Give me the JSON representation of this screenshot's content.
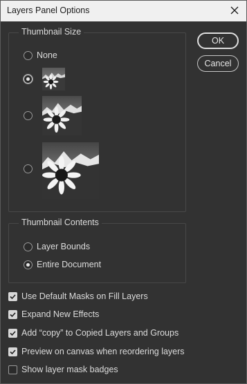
{
  "window": {
    "title": "Layers Panel Options",
    "close_icon": "close-icon"
  },
  "buttons": {
    "ok": "OK",
    "cancel": "Cancel"
  },
  "thumbnail_size": {
    "label": "Thumbnail Size",
    "options": [
      {
        "id": "none",
        "label": "None",
        "selected": false
      },
      {
        "id": "small",
        "label": "",
        "selected": true
      },
      {
        "id": "medium",
        "label": "",
        "selected": false
      },
      {
        "id": "large",
        "label": "",
        "selected": false
      }
    ]
  },
  "thumbnail_contents": {
    "label": "Thumbnail Contents",
    "options": [
      {
        "id": "layer-bounds",
        "label": "Layer Bounds",
        "selected": false
      },
      {
        "id": "entire-document",
        "label": "Entire Document",
        "selected": true
      }
    ]
  },
  "checkboxes": [
    {
      "label": "Use Default Masks on Fill Layers",
      "checked": true
    },
    {
      "label": "Expand New Effects",
      "checked": true
    },
    {
      "label": "Add “copy” to Copied Layers and Groups",
      "checked": true
    },
    {
      "label": "Preview on canvas when reordering layers",
      "checked": true
    },
    {
      "label": "Show layer mask badges",
      "checked": false
    }
  ],
  "colors": {
    "background": "#323232",
    "titlebar": "#f0f0f0",
    "text": "#dcdcdc"
  }
}
